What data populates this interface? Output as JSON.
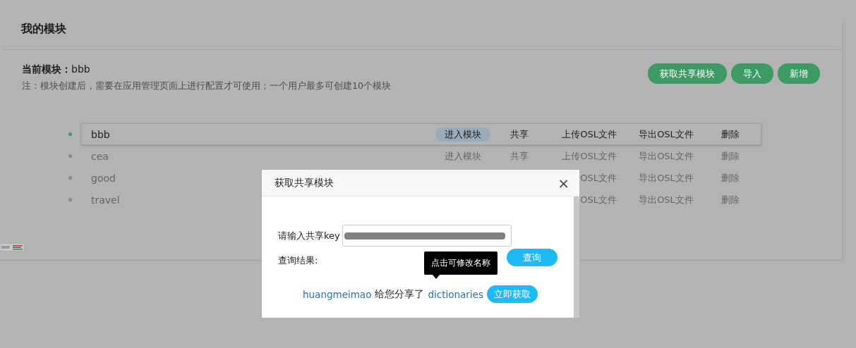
{
  "page": {
    "title": "我的模块",
    "current_label": "当前模块：",
    "current_value": "bbb",
    "note": "注：模块创建后，需要在应用管理页面上进行配置才可使用；一个用户最多可创建10个模块"
  },
  "buttons": [
    "获取共享模块",
    "导入",
    "新增"
  ],
  "modules": [
    {
      "name": "bbb",
      "selected": true,
      "enter": "进入模块",
      "share": "共享",
      "upload": "上传OSL文件",
      "export": "导出OSL文件",
      "delete": "删除"
    },
    {
      "name": "cea",
      "selected": false,
      "enter": "进入模块",
      "share": "共享",
      "upload": "上传OSL文件",
      "export": "导出OSL文件",
      "delete": "删除"
    },
    {
      "name": "good",
      "selected": false,
      "upload": "OSL文件",
      "export": "导出OSL文件",
      "delete": "删除"
    },
    {
      "name": "travel",
      "selected": false,
      "upload": "OSL文件",
      "export": "导出OSL文件",
      "delete": "删除"
    }
  ],
  "dialog": {
    "title": "获取共享模块",
    "close": "×",
    "key_label": "请输入共享key",
    "result_label": "查询结果:",
    "query_button": "查询",
    "tooltip": "点击可修改名称",
    "share_user": "huangmeimao",
    "share_text": "给您分享了",
    "share_module": "dictionaries",
    "get_button": "立即获取"
  }
}
